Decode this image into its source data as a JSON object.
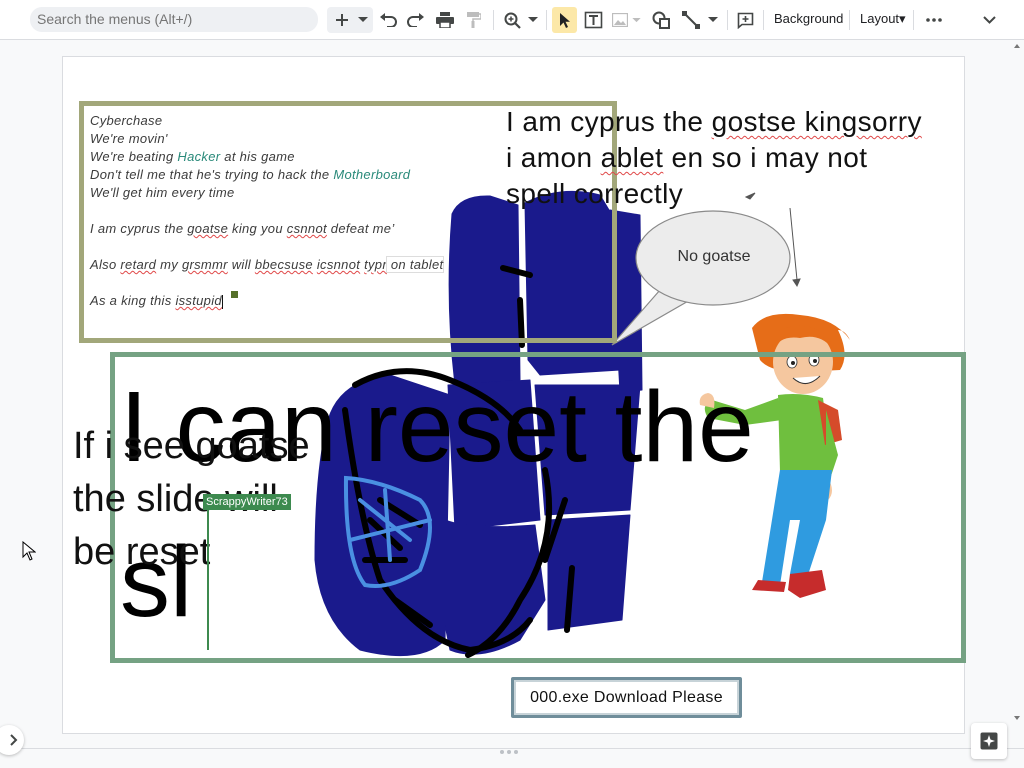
{
  "toolbar": {
    "search_placeholder": "Search the menus (Alt+/)",
    "background_label": "Background",
    "layout_label": "Layout",
    "layout_dropdown_arrow": "▾",
    "icons": [
      "plus-icon",
      "chevron-down-icon",
      "undo-icon",
      "redo-icon",
      "print-icon",
      "paint-format-icon",
      "zoom-icon",
      "select-icon",
      "text-box-icon",
      "image-icon",
      "shape-icon",
      "line-icon",
      "comment-icon",
      "more-icon",
      "collapse-icon"
    ]
  },
  "slide": {
    "text_box": {
      "lines": [
        {
          "parts": [
            {
              "t": "Cyberchase"
            }
          ]
        },
        {
          "parts": [
            {
              "t": "We're movin'"
            }
          ]
        },
        {
          "parts": [
            {
              "t": "We're beating "
            },
            {
              "t": "Hacker",
              "c": "teal"
            },
            {
              "t": " at his game"
            }
          ]
        },
        {
          "parts": [
            {
              "t": "Don't tell me that he's trying to hack the "
            },
            {
              "t": "Motherboard",
              "c": "teal"
            }
          ]
        },
        {
          "parts": [
            {
              "t": "We'll get him every time"
            }
          ]
        },
        {
          "parts": []
        },
        {
          "parts": [
            {
              "t": "I am cyprus the "
            },
            {
              "t": "goatse",
              "c": "squig"
            },
            {
              "t": " king you "
            },
            {
              "t": "csnnot",
              "c": "squig"
            },
            {
              "t": " defeat me’"
            }
          ]
        },
        {
          "parts": []
        },
        {
          "parts": [
            {
              "t": "Also "
            },
            {
              "t": "retard",
              "c": "squig"
            },
            {
              "t": " my "
            },
            {
              "t": "grsmmr",
              "c": "squig"
            },
            {
              "t": " will "
            },
            {
              "t": "bbecsuse",
              "c": "squig"
            },
            {
              "t": " "
            },
            {
              "t": "icsnnot",
              "c": "squig"
            },
            {
              "t": " "
            },
            {
              "t": "typr",
              "c": "squig"
            },
            {
              "t": " on tablet",
              "c": "hl"
            }
          ]
        },
        {
          "parts": []
        },
        {
          "parts": [
            {
              "t": "As a king this "
            },
            {
              "t": "isstupid",
              "c": "squig"
            }
          ]
        }
      ]
    },
    "right_text_lines": [
      [
        {
          "t": "I am cyprus the "
        },
        {
          "t": "gostse kingsorry",
          "c": "squig"
        }
      ],
      [
        {
          "t": "i amon "
        },
        {
          "t": "ablet",
          "c": "squig"
        },
        {
          "t": " en so i may not"
        }
      ],
      [
        {
          "t": "spell correctly"
        }
      ]
    ],
    "bubble_text": "No goatse",
    "huge_text_line1": "I can reset the",
    "huge_text_line2": "sl",
    "left_text": "If i see goatse the slide will be reset",
    "collaborator_name": "ScrappyWriter73",
    "download_box_text": "000.exe Download Please"
  },
  "colors": {
    "olive_frame": "#a2a77a",
    "green_frame": "#75a283",
    "scribble_blue": "#1a1a8c",
    "collaborator": "#3d8a4f"
  }
}
